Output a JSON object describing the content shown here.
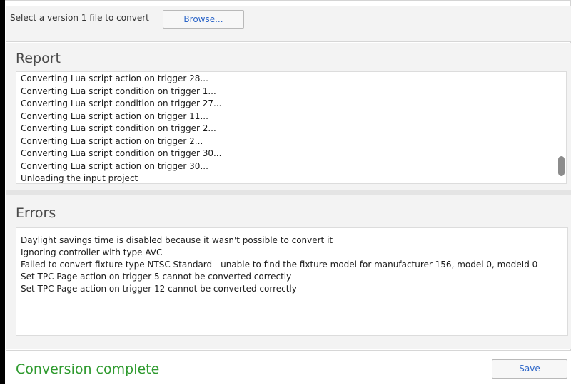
{
  "top": {
    "select_label": "Select a version 1 file to convert",
    "browse_label": "Browse..."
  },
  "report": {
    "title": "Report",
    "lines": [
      "Converting Lua script action on trigger 28...",
      "Converting Lua script condition on trigger 1...",
      "Converting Lua script condition on trigger 27...",
      "Converting Lua script action on trigger 11...",
      "Converting Lua script condition on trigger 2...",
      "Converting Lua script action on trigger 2...",
      "Converting Lua script condition on trigger 30...",
      "Converting Lua script action on trigger 30...",
      "Unloading the input project"
    ]
  },
  "errors": {
    "title": "Errors",
    "lines": [
      "Daylight savings time is disabled because it wasn't possible to convert it",
      "Ignoring controller  with type AVC",
      "Failed to convert fixture type NTSC Standard - unable to find the fixture model for manufacturer 156, model 0, modeId 0",
      "Set TPC Page action on trigger 5 cannot be converted correctly",
      "Set TPC Page action on trigger 12 cannot be converted correctly"
    ]
  },
  "footer": {
    "status": "Conversion complete",
    "save_label": "Save"
  },
  "colors": {
    "status_green": "#2e9a2e",
    "button_text_blue": "#2a64c8",
    "panel_bg": "#f3f3f3"
  }
}
